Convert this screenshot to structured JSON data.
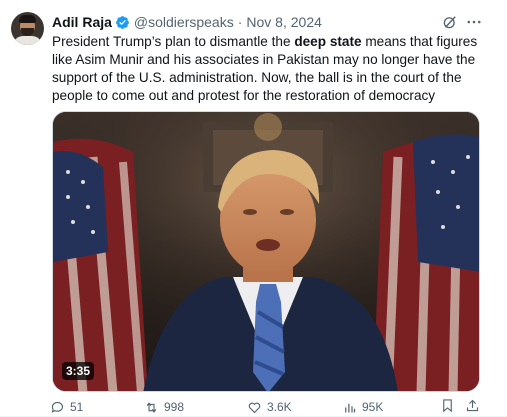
{
  "tweet": {
    "author_name": "Adil Raja",
    "handle": "@soldierspeaks",
    "separator": "·",
    "date": "Nov 8, 2024",
    "text_part1": "President Trump’s plan to dismantle the ",
    "text_bold": "deep state",
    "text_part2": " means that figures like Asim Munir and his associates in Pakistan may no longer have the support of the U.S. administration. Now, the ball is in the court of the people to come out and protest for the restoration of democracy",
    "video_duration": "3:35"
  },
  "actions": {
    "replies": "51",
    "reposts": "998",
    "likes": "3.6K",
    "views": "95K"
  },
  "colors": {
    "accent": "#1d9bf0",
    "muted": "#536471",
    "text": "#0f1419"
  },
  "icons": [
    "verified-badge-icon",
    "grok-icon",
    "more-icon",
    "reply-icon",
    "repost-icon",
    "like-icon",
    "views-icon",
    "bookmark-icon",
    "share-icon"
  ]
}
